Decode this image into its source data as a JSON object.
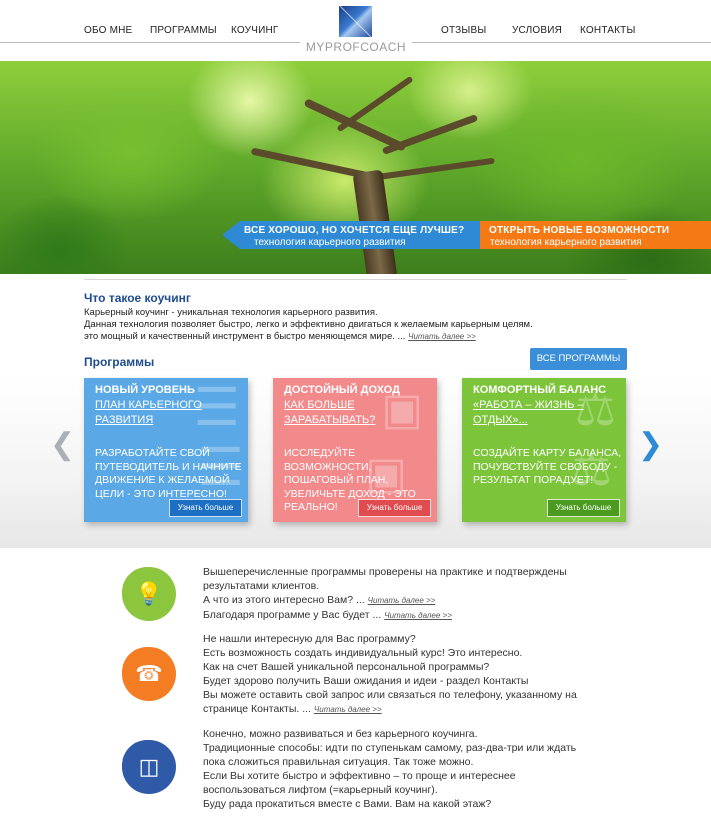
{
  "nav": {
    "items_left": [
      "ОБО МНЕ",
      "ПРОГРАММЫ",
      "КОУЧИНГ"
    ],
    "items_right": [
      "ОТЗЫВЫ",
      "УСЛОВИЯ",
      "КОНТАКТЫ"
    ],
    "logo_text": "MYPROFCOACH"
  },
  "hero": {
    "banner1": {
      "title": "ВСЕ ХОРОШО, НО ХОЧЕТСЯ ЕЩЕ ЛУЧШЕ?",
      "subtitle": "технология карьерного развития"
    },
    "banner2": {
      "title": "ОТКРЫТЬ НОВЫЕ ВОЗМОЖНОСТИ",
      "subtitle": "технология карьерного развития"
    }
  },
  "coaching": {
    "heading": "Что такое коучинг",
    "line1": "Карьерный коучинг - уникальная технология карьерного развития.",
    "line2": "Данная технология позволяет быстро, легко и эффективно двигаться к желаемым карьерным целям.",
    "line3": "это мощный и качественный инструмент в быстро меняющемся мире. ...",
    "more": "Читать далее >>"
  },
  "programs": {
    "heading": "Программы",
    "all_button": "ВСЕ ПРОГРАММЫ",
    "cards": [
      {
        "title": "НОВЫЙ УРОВЕНЬ",
        "subtitle": "ПЛАН КАРЬЕРНОГО РАЗВИТИЯ",
        "body": "РАЗРАБОТАЙТЕ СВОЙ ПУТЕВОДИТЕЛЬ И НАЧНИТЕ ДВИЖЕНИЕ К ЖЕЛАЕМОЙ ЦЕЛИ - ЭТО ИНТЕРЕСНО!",
        "button": "Узнать больше",
        "color": "#5aa8e6"
      },
      {
        "title": "ДОСТОЙНЫЙ ДОХОД",
        "subtitle": "КАК БОЛЬШЕ ЗАРАБАТЫВАТЬ?",
        "body": "ИССЛЕДУЙТЕ ВОЗМОЖНОСТИ, ПОШАГОВЫЙ ПЛАН, УВЕЛИЧЬТЕ ДОХОД - ЭТО РЕАЛЬНО!",
        "button": "Узнать больше",
        "color": "#f28a8c"
      },
      {
        "title": "КОМФОРТНЫЙ БАЛАНС",
        "subtitle": "«РАБОТА – ЖИЗНЬ – ОТДЫХ»...",
        "body": "СОЗДАЙТЕ КАРТУ БАЛАНСА, ПОЧУВСТВУЙТЕ СВОБОДУ - РЕЗУЛЬТАТ ПОРАДУЕТ!",
        "button": "Узнать больше",
        "color": "#7cc53a"
      }
    ]
  },
  "features": [
    {
      "icon": "lightbulb-icon",
      "color": "#8cc63f",
      "lines": [
        "Вышеперечисленные программы проверены на практике и подтверждены",
        "результатами клиентов.",
        "А что из этого интересно Вам? ...",
        "Благодаря программе у Вас будет ..."
      ],
      "more": "Читать далее >>"
    },
    {
      "icon": "phone-icon",
      "color": "#f47c22",
      "lines": [
        "Не нашли интересную для Вас программу?",
        "Есть возможность создать индивидуальный курс! Это интересно.",
        "Как на счет Вашей уникальной персональной программы?",
        "Будет здорово получить Ваши ожидания и идеи - раздел Контакты",
        "Вы можете оставить свой запрос или связаться по телефону, указанному на",
        "странице Контакты. ..."
      ],
      "more": "Читать далее >>"
    },
    {
      "icon": "elevator-icon",
      "color": "#2e5aa8",
      "lines": [
        "Конечно, можно развиваться и без карьерного коучинга.",
        "Традиционные способы: идти по ступенькам самому, раз-два-три или ждать",
        "пока сложиться правильная ситуация. Так тоже можно.",
        "Если Вы хотите быстро и эффективно – то проще и интереснее",
        "воспользоваться лифтом (=карьерный коучинг).",
        "Буду рада прокатиться вместе с Вами. Вам на какой этаж?"
      ]
    }
  ]
}
